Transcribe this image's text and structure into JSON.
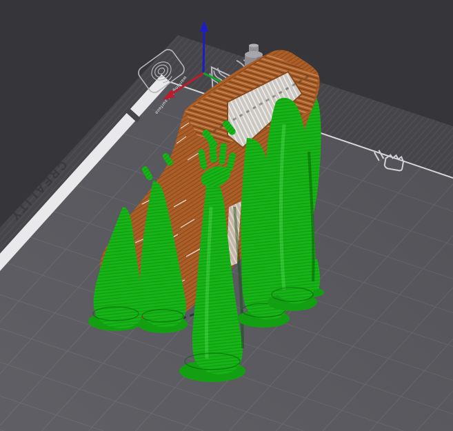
{
  "viewport": {
    "plate": {
      "brand": "CREALITY",
      "warning_label": "warning hot surface",
      "icons": [
        {
          "name": "fingerprint-icon"
        },
        {
          "name": "hot-surface-warning-triangle-icon"
        },
        {
          "name": "hand-hot-surface-icon"
        }
      ]
    },
    "axes": {
      "x_color": "#c11a2a",
      "y_color": "#13a32a",
      "z_color": "#1d1dc8"
    },
    "colors": {
      "background": "#36363a",
      "platform_band": "#45454a",
      "plate_surface": "#56565c",
      "grid_line": "#6a6a71",
      "edge_strip": "#e9e9ec",
      "brand_text": "#3a3a3e",
      "label_line": "#b6b6ba",
      "model": "#ad5f28",
      "model_layer_line": "#8a491d",
      "infill_light": "#cbc7c2",
      "support": "#17b417",
      "support_ring": "#0e9110",
      "prime_tower": "#8d8d92"
    }
  }
}
